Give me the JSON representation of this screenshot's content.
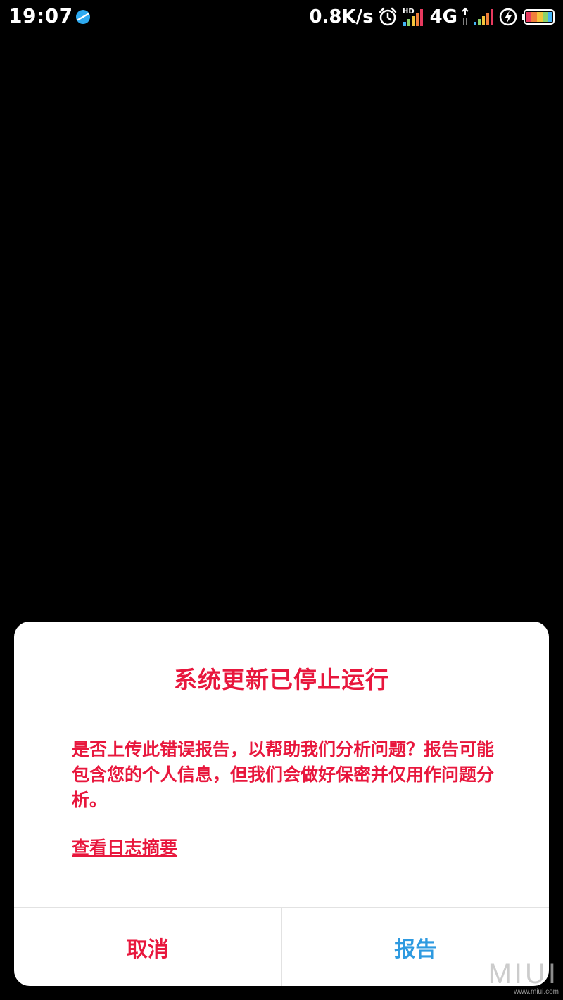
{
  "status_bar": {
    "time": "19:07",
    "net_speed": "0.8K/s",
    "network_type": "4G",
    "hd_label": "HD",
    "icons": [
      "app-notification-icon",
      "alarm-clock-icon",
      "hd-signal-icon",
      "signal-strength-icon",
      "charging-icon",
      "battery-icon"
    ],
    "app_icon_color": "#2eaaf0"
  },
  "dialog": {
    "title": "系统更新已停止运行",
    "message": "是否上传此错误报告，以帮助我们分析问题？报告可能包含您的个人信息，但我们会做好保密并仅用作问题分析。",
    "log_link": "查看日志摘要",
    "cancel_label": "取消",
    "report_label": "报告",
    "accent_color": "#e8173d",
    "report_color": "#2e9ae0"
  },
  "watermark": {
    "logo": "MIUI",
    "url": "www.miui.com"
  }
}
